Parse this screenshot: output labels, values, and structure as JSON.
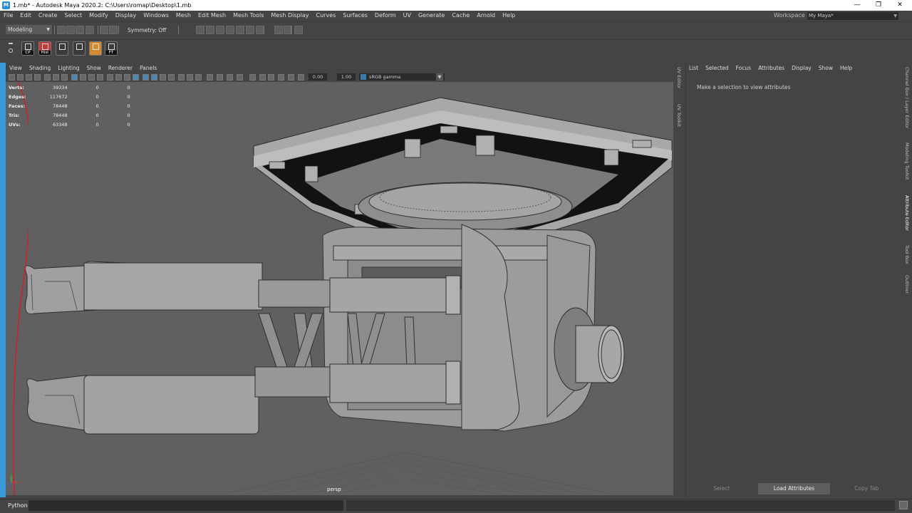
{
  "titlebar": {
    "title": "1.mb* - Autodesk Maya 2020.2: C:\\Users\\romap\\Desktop\\1.mb",
    "minimize": "—",
    "maximize": "❐",
    "close": "✕"
  },
  "menubar": {
    "items": [
      "File",
      "Edit",
      "Create",
      "Select",
      "Modify",
      "Display",
      "Windows",
      "Mesh",
      "Edit Mesh",
      "Mesh Tools",
      "Mesh Display",
      "Curves",
      "Surfaces",
      "Deform",
      "UV",
      "Generate",
      "Cache",
      "Arnold",
      "Help"
    ]
  },
  "workspace": {
    "label": "Workspace :",
    "value": "My Maya*"
  },
  "statusline": {
    "mode": "Modeling",
    "symmetry": "Symmetry: Off"
  },
  "shelf": {
    "buttons": [
      {
        "label": "CP",
        "icon": "cp-icon"
      },
      {
        "label": "Hist",
        "icon": "history-icon"
      },
      {
        "label": "",
        "icon": "grid-icon"
      },
      {
        "label": "",
        "icon": "frame-icon"
      },
      {
        "label": "",
        "icon": "cube-icon"
      },
      {
        "label": "FT",
        "icon": "freeze-transform-icon"
      }
    ]
  },
  "viewport": {
    "menu": [
      "View",
      "Shading",
      "Lighting",
      "Show",
      "Renderer",
      "Panels"
    ],
    "exposure": "0.00",
    "gamma": "1.00",
    "colorspace": "sRGB gamma",
    "camera": "persp",
    "hud": [
      {
        "label": "Verts:",
        "value": "39334",
        "sel": "0",
        "comp": "0"
      },
      {
        "label": "Edges:",
        "value": "117672",
        "sel": "0",
        "comp": "0"
      },
      {
        "label": "Faces:",
        "value": "78448",
        "sel": "0",
        "comp": "0"
      },
      {
        "label": "Tris:",
        "value": "78448",
        "sel": "0",
        "comp": "0"
      },
      {
        "label": "UVs:",
        "value": "63348",
        "sel": "0",
        "comp": "0"
      }
    ]
  },
  "left_vtabs": [
    "UV Editor",
    "UV Toolkit"
  ],
  "right_vtabs": [
    "Channel Box / Layer Editor",
    "Modeling Toolkit",
    "Attribute Editor",
    "Tool Box",
    "Outliner"
  ],
  "attribute_editor": {
    "menu": [
      "List",
      "Selected",
      "Focus",
      "Attributes",
      "Display",
      "Show",
      "Help"
    ],
    "message": "Make a selection to view attributes",
    "buttons": {
      "select": "Select",
      "load": "Load Attributes",
      "copy": "Copy Tab"
    }
  },
  "cmdline": {
    "language": "Python"
  },
  "colors": {
    "accent": "#3a9ad9",
    "panel": "#444444",
    "viewport": "#606060",
    "model": "#9a9a9a"
  }
}
